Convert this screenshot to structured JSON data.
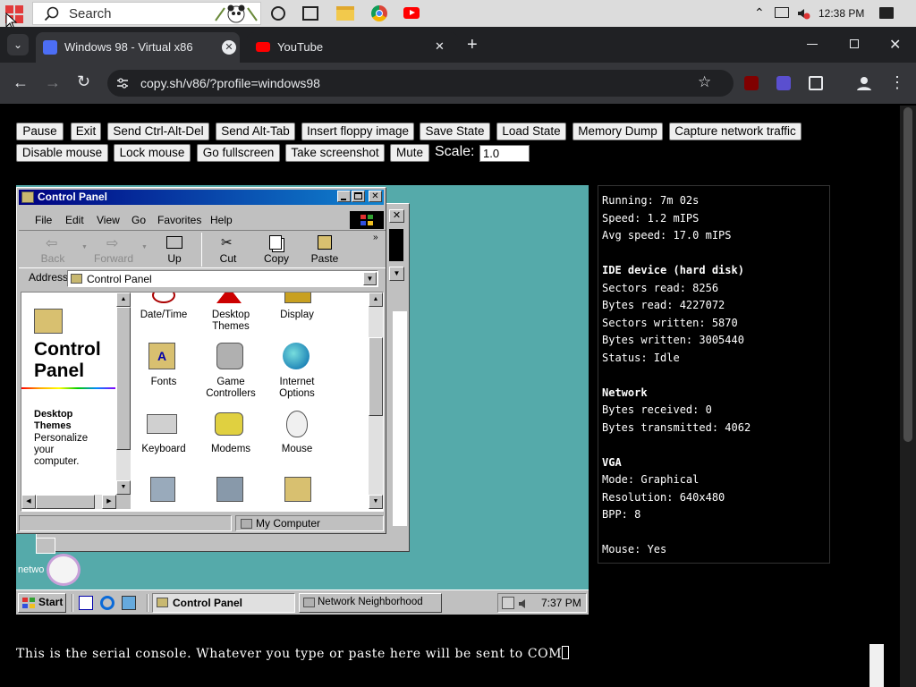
{
  "host": {
    "search_placeholder": "Search",
    "clock": "12:38 PM"
  },
  "browser": {
    "tabs": [
      {
        "label": "Windows 98 - Virtual x86",
        "active": true
      },
      {
        "label": "YouTube",
        "active": false
      }
    ],
    "url": "copy.sh/v86/?profile=windows98"
  },
  "controls": {
    "row1": [
      "Pause",
      "Exit",
      "Send Ctrl-Alt-Del",
      "Send Alt-Tab",
      "Insert floppy image",
      "Save State",
      "Load State",
      "Memory Dump",
      "Capture network traffic"
    ],
    "row2": [
      "Disable mouse",
      "Lock mouse",
      "Go fullscreen",
      "Take screenshot",
      "Mute"
    ],
    "scale_label": "Scale:",
    "scale_value": "1.0"
  },
  "win98": {
    "window_title": "Control Panel",
    "menu": [
      "File",
      "Edit",
      "View",
      "Go",
      "Favorites",
      "Help"
    ],
    "toolbar": [
      "Back",
      "Forward",
      "Up",
      "Cut",
      "Copy",
      "Paste"
    ],
    "address_label": "Address",
    "address_value": "Control Panel",
    "sidebar_title_1": "Control",
    "sidebar_title_2": "Panel",
    "sidebar_item_title": "Desktop Themes",
    "sidebar_item_desc": "Personalize your computer.",
    "icons": [
      {
        "label": "Date/Time"
      },
      {
        "label": "Desktop Themes"
      },
      {
        "label": "Display"
      },
      {
        "label": "Fonts"
      },
      {
        "label": "Game Controllers"
      },
      {
        "label": "Internet Options"
      },
      {
        "label": "Keyboard"
      },
      {
        "label": "Modems"
      },
      {
        "label": "Mouse"
      }
    ],
    "status_location": "My Computer",
    "desktop_icon_label": "netwo",
    "start_label": "Start",
    "taskbar_buttons": [
      "Control Panel",
      "Network Neighborhood"
    ],
    "clock": "7:37 PM"
  },
  "stats": {
    "running": "Running: 7m 02s",
    "speed": "Speed: 1.2 mIPS",
    "avg_speed": "Avg speed: 17.0 mIPS",
    "ide_header": "IDE device (hard disk)",
    "sectors_read": "Sectors read: 8256",
    "bytes_read": "Bytes read: 4227072",
    "sectors_written": "Sectors written: 5870",
    "bytes_written": "Bytes written: 3005440",
    "status": "Status: Idle",
    "net_header": "Network",
    "bytes_received": "Bytes received: 0",
    "bytes_transmitted": "Bytes transmitted: 4062",
    "vga_header": "VGA",
    "mode": "Mode: Graphical",
    "resolution": "Resolution: 640x480",
    "bpp": "BPP: 8",
    "mouse": "Mouse: Yes"
  },
  "serial": {
    "text": "This is the serial console. Whatever you type or paste here will be sent to COM"
  }
}
